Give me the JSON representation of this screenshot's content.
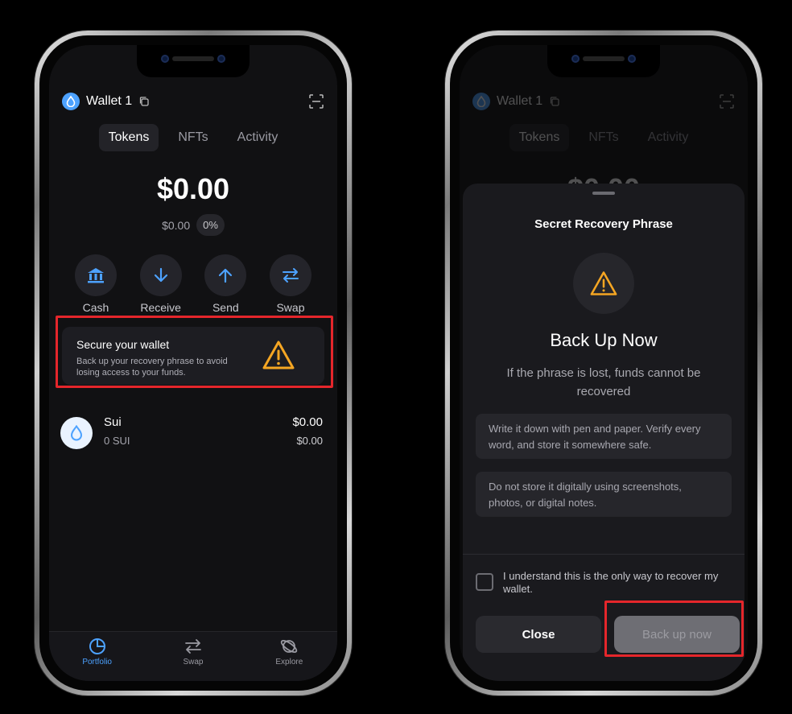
{
  "left_phone": {
    "wallet_name": "Wallet 1",
    "tabs": [
      "Tokens",
      "NFTs",
      "Activity"
    ],
    "active_tab": "Tokens",
    "balance": "$0.00",
    "sub_balance": "$0.00",
    "change_pct": "0%",
    "actions": [
      {
        "label": "Cash",
        "icon": "bank-icon"
      },
      {
        "label": "Receive",
        "icon": "arrow-down-icon"
      },
      {
        "label": "Send",
        "icon": "arrow-up-icon"
      },
      {
        "label": "Swap",
        "icon": "swap-icon"
      }
    ],
    "secure_card": {
      "title": "Secure your wallet",
      "description": "Back up your recovery phrase to avoid losing access to your funds."
    },
    "token": {
      "name": "Sui",
      "amount": "0 SUI",
      "value": "$0.00",
      "value_secondary": "$0.00"
    },
    "bottom_nav": [
      "Portfolio",
      "Swap",
      "Explore"
    ],
    "active_nav": "Portfolio"
  },
  "right_phone": {
    "wallet_name": "Wallet 1",
    "tabs": [
      "Tokens",
      "NFTs",
      "Activity"
    ],
    "partial_balance": "$0.00",
    "sheet": {
      "title": "Secret Recovery Phrase",
      "heading": "Back Up Now",
      "description": "If the phrase is lost, funds cannot be recovered",
      "tips": [
        "Write it down with pen and paper. Verify every word, and store it somewhere safe.",
        "Do not store it digitally using screenshots, photos, or digital notes."
      ],
      "checkbox_label": "I understand this is the only way to recover my wallet.",
      "checkbox_checked": false,
      "close_label": "Close",
      "backup_label": "Back up now"
    }
  },
  "colors": {
    "accent": "#4da2ff",
    "warning": "#f5a623",
    "highlight": "#e5262b",
    "background": "#111113"
  }
}
